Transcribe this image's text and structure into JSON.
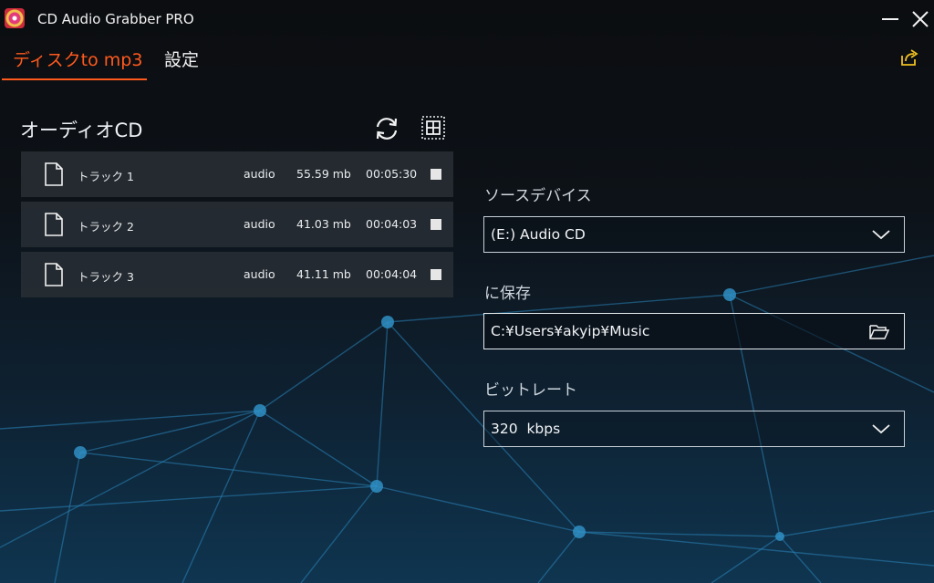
{
  "window": {
    "title": "CD Audio Grabber PRO"
  },
  "tabs": [
    {
      "label": "ディスクto mp3",
      "active": true
    },
    {
      "label": "設定",
      "active": false
    }
  ],
  "audio_cd": {
    "title": "オーディオCD",
    "tracks": [
      {
        "name": "トラック 1",
        "format": "audio",
        "size": "55.59 mb",
        "duration": "00:05:30",
        "checked": false
      },
      {
        "name": "トラック 2",
        "format": "audio",
        "size": "41.03 mb",
        "duration": "00:04:03",
        "checked": false
      },
      {
        "name": "トラック 3",
        "format": "audio",
        "size": "41.11 mb",
        "duration": "00:04:04",
        "checked": false
      }
    ]
  },
  "settings": {
    "source_device": {
      "label": "ソースデバイス",
      "value": "(E:) Audio CD"
    },
    "save_to": {
      "label": "に保存",
      "value": "C:¥Users¥akyip¥Music"
    },
    "bitrate": {
      "label": "ビットレート",
      "value": "320  kbps"
    }
  },
  "colors": {
    "accent": "#ff5a1e",
    "background_top": "#0b0d10",
    "background_bottom": "#0f3550",
    "row_bg": "#262c33"
  },
  "icons": [
    "app-icon",
    "minimize-icon",
    "close-icon",
    "share-export-icon",
    "refresh-icon",
    "grid-select-icon",
    "file-icon",
    "chevron-down-icon",
    "folder-open-icon"
  ]
}
